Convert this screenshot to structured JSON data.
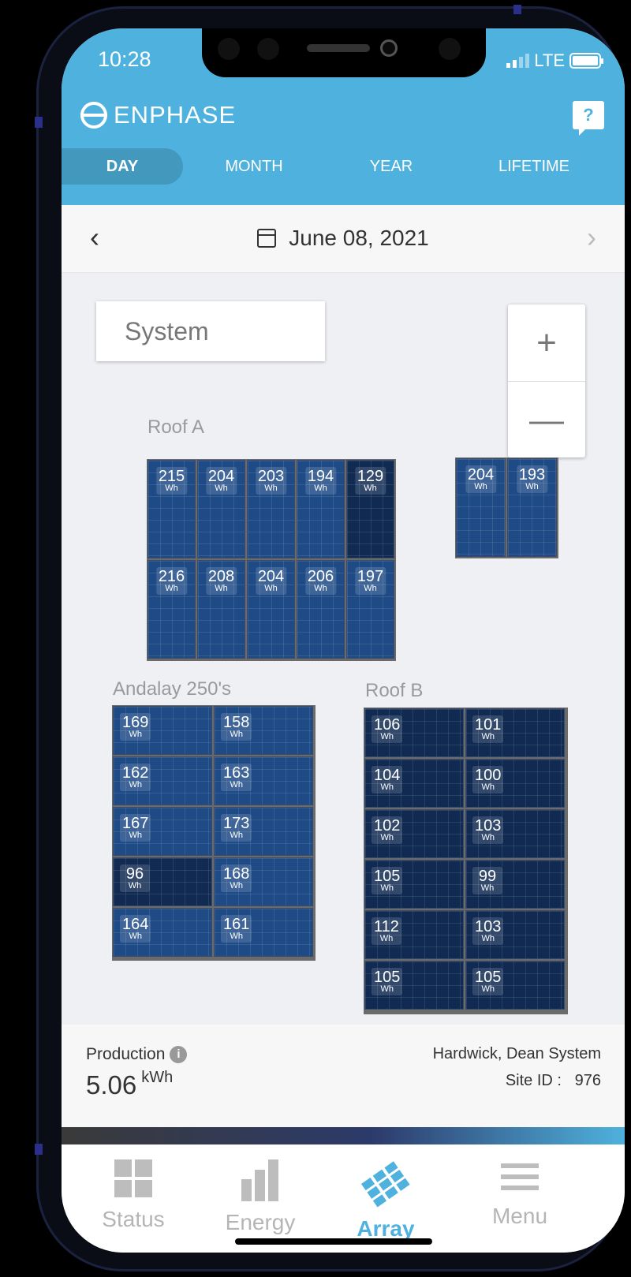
{
  "status_bar": {
    "time": "10:28",
    "network": "LTE"
  },
  "app": {
    "brand": "ENPHASE",
    "help_label": "?"
  },
  "period_tabs": [
    {
      "label": "DAY",
      "active": true
    },
    {
      "label": "MONTH",
      "active": false
    },
    {
      "label": "YEAR",
      "active": false
    },
    {
      "label": "LIFETIME",
      "active": false
    }
  ],
  "date_nav": {
    "prev_label": "‹",
    "date": "June 08, 2021",
    "next_label": "›"
  },
  "view_select": {
    "value": "System"
  },
  "zoom": {
    "in_label": "+",
    "out_label": "—"
  },
  "unit": "Wh",
  "arrays": {
    "roof_a": {
      "label": "Roof A",
      "rows": [
        [
          "215",
          "204",
          "203",
          "194",
          "129"
        ],
        [
          "216",
          "208",
          "204",
          "206",
          "197"
        ]
      ],
      "extra": [
        "204",
        "193"
      ]
    },
    "andalay": {
      "label": "Andalay 250's",
      "rows": [
        [
          "169",
          "158"
        ],
        [
          "162",
          "163"
        ],
        [
          "167",
          "173"
        ],
        [
          "96",
          "168"
        ],
        [
          "164",
          "161"
        ]
      ]
    },
    "roof_b": {
      "label": "Roof B",
      "rows": [
        [
          "106",
          "101"
        ],
        [
          "104",
          "100"
        ],
        [
          "102",
          "103"
        ],
        [
          "105",
          "99"
        ],
        [
          "112",
          "103"
        ],
        [
          "105",
          "105"
        ]
      ]
    }
  },
  "production": {
    "label": "Production",
    "value": "5.06",
    "unit": "kWh",
    "system_name": "Hardwick, Dean System",
    "site_id_label": "Site ID :",
    "site_id": "976"
  },
  "bottom_nav": [
    {
      "label": "Status",
      "icon": "grid-icon",
      "active": false
    },
    {
      "label": "Energy",
      "icon": "bar-chart-icon",
      "active": false
    },
    {
      "label": "Array",
      "icon": "array-icon",
      "active": true
    },
    {
      "label": "Menu",
      "icon": "hamburger-icon",
      "active": false
    }
  ],
  "colors": {
    "header": "#4fb1dd",
    "panel": "#1e4b86",
    "panel_dark": "#102a52",
    "active_nav": "#4fb1dd"
  }
}
